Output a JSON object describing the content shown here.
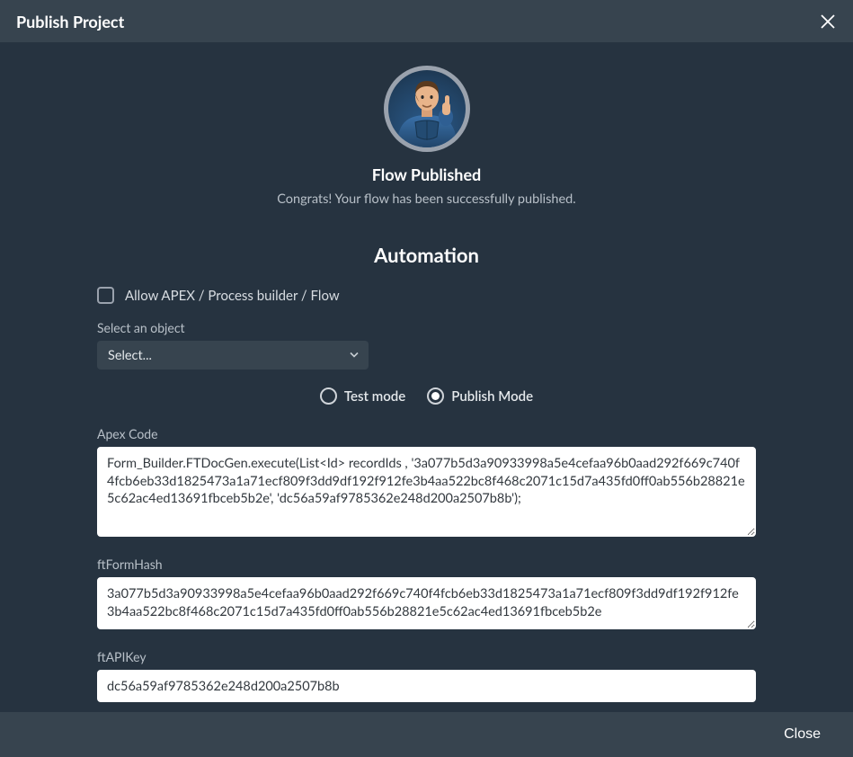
{
  "header": {
    "title": "Publish Project"
  },
  "hero": {
    "title": "Flow Published",
    "subtitle": "Congrats! Your flow has been successfully published."
  },
  "automation": {
    "title": "Automation",
    "allow_label": "Allow APEX / Process builder / Flow",
    "allow_checked": false,
    "select_label": "Select an object",
    "select_value": "Select...",
    "mode": {
      "test_label": "Test mode",
      "publish_label": "Publish Mode",
      "selected": "publish"
    },
    "apex": {
      "label": "Apex Code",
      "value": "Form_Builder.FTDocGen.execute(List<Id> recordIds , '3a077b5d3a90933998a5e4cefaa96b0aad292f669c740f4fcb6eb33d1825473a1a71ecf809f3dd9df192f912fe3b4aa522bc8f468c2071c15d7a435fd0ff0ab556b28821e5c62ac4ed13691fbceb5b2e', 'dc56a59af9785362e248d200a2507b8b');"
    },
    "formhash": {
      "label": "ftFormHash",
      "value": "3a077b5d3a90933998a5e4cefaa96b0aad292f669c740f4fcb6eb33d1825473a1a71ecf809f3dd9df192f912fe3b4aa522bc8f468c2071c15d7a435fd0ff0ab556b28821e5c62ac4ed13691fbceb5b2e"
    },
    "apikey": {
      "label": "ftAPIKey",
      "value": "dc56a59af9785362e248d200a2507b8b"
    }
  },
  "footer": {
    "close_label": "Close"
  }
}
